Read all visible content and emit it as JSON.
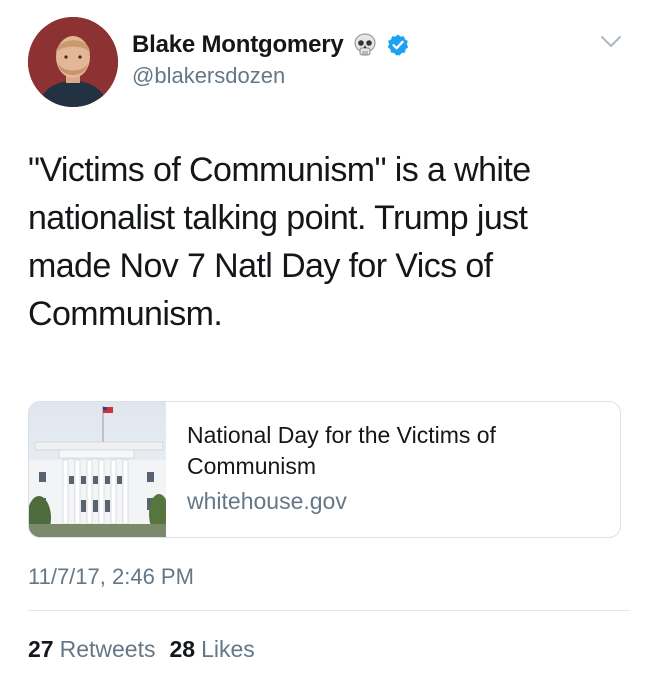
{
  "author": {
    "display_name": "Blake Montgomery",
    "handle": "@blakersdozen",
    "name_emoji": "skull-icon",
    "verified": true
  },
  "tweet": {
    "text": "\"Victims of Communism\" is a white nationalist talking point. Trump just made Nov 7 Natl Day for Vics of Communism.",
    "timestamp": "11/7/17, 2:46 PM"
  },
  "link_card": {
    "title": "National Day for the Victims of Communism",
    "domain": "whitehouse.gov",
    "image": "white-house-photo"
  },
  "stats": {
    "retweets_count": "27",
    "retweets_label": "Retweets",
    "likes_count": "28",
    "likes_label": "Likes"
  },
  "colors": {
    "text_primary": "#14171a",
    "text_secondary": "#657786",
    "verified_blue": "#1da1f2",
    "border": "#d9e1e8"
  }
}
